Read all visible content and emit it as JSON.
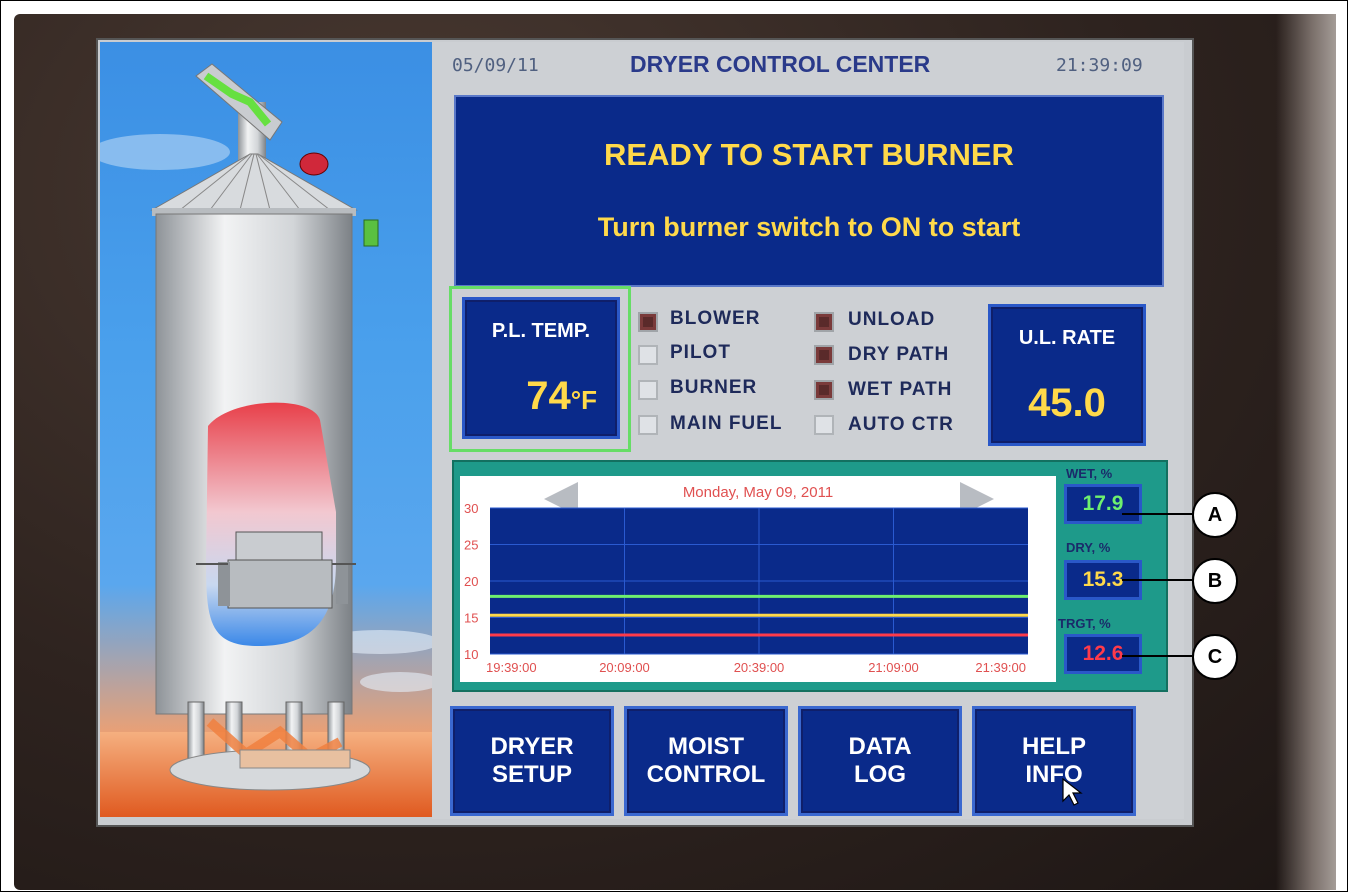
{
  "header": {
    "date": "05/09/11",
    "title": "DRYER CONTROL CENTER",
    "time": "21:39:09"
  },
  "message": {
    "line1": "READY TO START BURNER",
    "line2": "Turn burner switch to ON to start"
  },
  "pl_temp": {
    "label": "P.L. TEMP.",
    "value": "74",
    "unit": "°F"
  },
  "ul_rate": {
    "label": "U.L. RATE",
    "value": "45.0"
  },
  "indicators_left": [
    {
      "label": "BLOWER",
      "on": true
    },
    {
      "label": "PILOT",
      "on": false
    },
    {
      "label": "BURNER",
      "on": false
    },
    {
      "label": "MAIN FUEL",
      "on": false
    }
  ],
  "indicators_right": [
    {
      "label": "UNLOAD",
      "on": true
    },
    {
      "label": "DRY PATH",
      "on": true
    },
    {
      "label": "WET PATH",
      "on": true
    },
    {
      "label": "AUTO CTR",
      "on": false
    }
  ],
  "trend": {
    "date": "Monday, May 09, 2011",
    "y_ticks": [
      "30",
      "25",
      "20",
      "15",
      "10"
    ],
    "x_ticks": [
      "19:39:00",
      "20:09:00",
      "20:39:00",
      "21:09:00",
      "21:39:00"
    ]
  },
  "readouts": {
    "wet": {
      "label": "WET, %",
      "value": "17.9",
      "color": "#6ef06e"
    },
    "dry": {
      "label": "DRY, %",
      "value": "15.3",
      "color": "#ffd94a"
    },
    "trgt": {
      "label": "TRGT, %",
      "value": "12.6",
      "color": "#ff3a4a"
    }
  },
  "buttons": {
    "dryer_setup": [
      "DRYER",
      "SETUP"
    ],
    "moist_control": [
      "MOIST",
      "CONTROL"
    ],
    "data_log": [
      "DATA",
      "LOG"
    ],
    "help_info": [
      "HELP",
      "INFO"
    ]
  },
  "callouts": [
    "A",
    "B",
    "C"
  ],
  "chart_data": {
    "type": "line",
    "title": "Monday, May 09, 2011",
    "xlabel": "",
    "ylabel": "",
    "categories": [
      "19:39:00",
      "20:09:00",
      "20:39:00",
      "21:09:00",
      "21:39:00"
    ],
    "ylim": [
      10,
      30
    ],
    "series": [
      {
        "name": "WET, %",
        "color": "#6ef06e",
        "values": [
          17.9,
          17.9,
          17.9,
          17.9,
          17.9
        ]
      },
      {
        "name": "DRY, %",
        "color": "#ffd94a",
        "values": [
          15.3,
          15.3,
          15.3,
          15.3,
          15.3
        ]
      },
      {
        "name": "TRGT, %",
        "color": "#ff3a4a",
        "values": [
          12.6,
          12.6,
          12.6,
          12.6,
          12.6
        ]
      }
    ]
  }
}
